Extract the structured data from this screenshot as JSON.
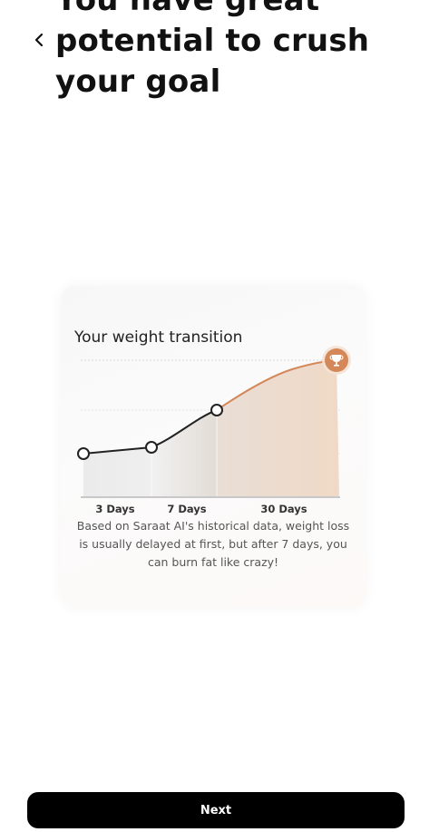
{
  "header": {
    "back_icon": "chevron-left-icon",
    "headline_lines": [
      "You have great",
      "potential to crush",
      "your goal"
    ]
  },
  "card": {
    "title": "Your weight transition",
    "trophy_icon": "trophy-icon",
    "description": "Based on Saraat AI's historical data, weight loss is usually delayed at first, but after 7 days, you can burn fat like crazy!",
    "accent_color": "#D4885A"
  },
  "chart_data": {
    "type": "area",
    "categories": [
      "3 Days",
      "7 Days",
      "30 Days"
    ],
    "title": "Your weight transition",
    "xlabel": "",
    "ylabel": "",
    "grid": true,
    "line_color": "#222222",
    "fill_color": "#E8C4A6",
    "accent_color": "#D4885A"
  },
  "footer": {
    "next_label": "Next"
  }
}
